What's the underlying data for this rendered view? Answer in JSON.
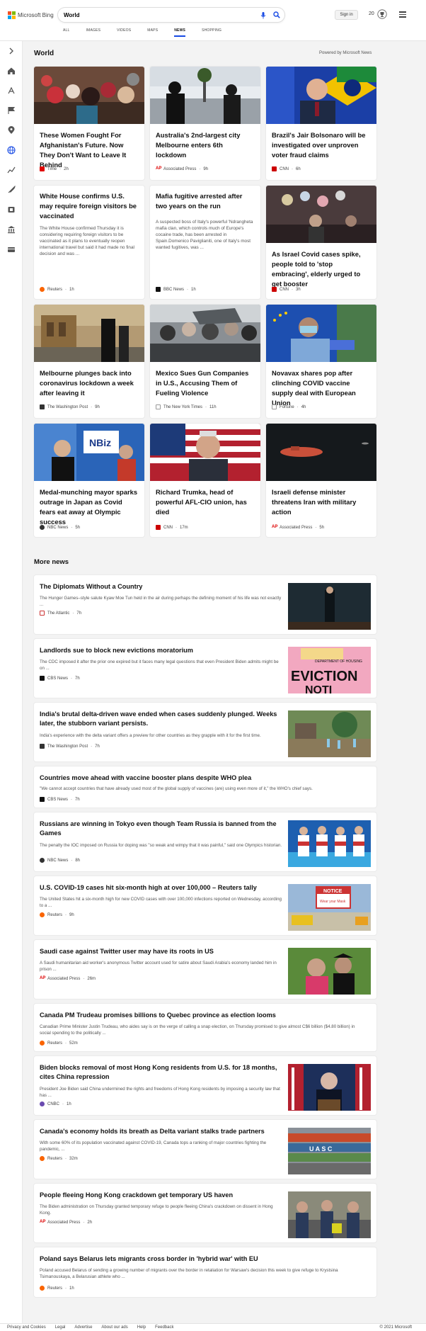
{
  "header": {
    "logo_text": "Microsoft Bing",
    "search_value": "World",
    "signin_label": "Sign in",
    "rewards_count": "20"
  },
  "tabs": [
    "ALL",
    "IMAGES",
    "VIDEOS",
    "MAPS",
    "NEWS",
    "SHOPPING"
  ],
  "section": {
    "title": "World",
    "powered": "Powered by Microsoft News"
  },
  "cards": [
    {
      "title": "These Women Fought For Afghanistan's Future. Now They Don't Want to Leave It Behind",
      "desc": "",
      "source": "Time",
      "time": "2h"
    },
    {
      "title": "Australia's 2nd-largest city Melbourne enters 6th lockdown",
      "desc": "",
      "source": "Associated Press",
      "time": "9h"
    },
    {
      "title": "Brazil's Jair Bolsonaro will be investigated over unproven voter fraud claims",
      "desc": "",
      "source": "CNN",
      "time": "6h"
    },
    {
      "title": "White House confirms U.S. may require foreign visitors be vaccinated",
      "desc": "The White House confirmed Thursday it is considering requiring foreign visitors to be vaccinated as it plans to eventually reopen international travel but said it had made no final decision and was ...",
      "source": "Reuters",
      "time": "1h"
    },
    {
      "title": "Mafia fugitive arrested after two years on the run",
      "desc": "A suspected boss of Italy's powerful 'Ndrangheta mafia clan, which controls much of Europe's cocaine trade, has been arrested in Spain.Domenico Paviglianiti, one of Italy's most wanted fugitives, was ...",
      "source": "BBC News",
      "time": "1h"
    },
    {
      "title": "As Israel Covid cases spike, people told to 'stop embracing', elderly urged to get booster",
      "desc": "",
      "source": "CNN",
      "time": "3h"
    },
    {
      "title": "Melbourne plunges back into coronavirus lockdown a week after leaving it",
      "desc": "",
      "source": "The Washington Post",
      "time": "9h"
    },
    {
      "title": "Mexico Sues Gun Companies in U.S., Accusing Them of Fueling Violence",
      "desc": "",
      "source": "The New York Times",
      "time": "11h"
    },
    {
      "title": "Novavax shares pop after clinching COVID vaccine supply deal with European Union",
      "desc": "",
      "source": "Fortune",
      "time": "4h"
    },
    {
      "title": "Medal-munching mayor sparks outrage in Japan as Covid fears eat away at Olympic success",
      "desc": "",
      "source": "NBC News",
      "time": "5h"
    },
    {
      "title": "Richard Trumka, head of powerful AFL-CIO union, has died",
      "desc": "",
      "source": "CNN",
      "time": "17m"
    },
    {
      "title": "Israeli defense minister threatens Iran with military action",
      "desc": "",
      "source": "Associated Press",
      "time": "5h"
    }
  ],
  "more_news": {
    "title": "More news",
    "items": [
      {
        "title": "The Diplomats Without a Country",
        "desc": "The Hunger Games–style salute Kyaw Moe Tun held in the air during perhaps the defining moment of his life was not exactly ...",
        "source": "The Atlantic",
        "time": "7h"
      },
      {
        "title": "Landlords sue to block new evictions moratorium",
        "desc": "The CDC imposed it after the prior one expired but it faces many legal questions that even President Biden admits might be on ...",
        "source": "CBS News",
        "time": "7h"
      },
      {
        "title": "India's brutal delta-driven wave ended when cases suddenly plunged. Weeks later, the stubborn variant persists.",
        "desc": "India's experience with the delta variant offers a preview for other countries as they grapple with it for the first time.",
        "source": "The Washington Post",
        "time": "7h"
      },
      {
        "title": "Countries move ahead with vaccine booster plans despite WHO plea",
        "desc": "\"We cannot accept countries that have already used most of the global supply of vaccines (are) using even more of it,\" the WHO's chief says.",
        "source": "CBS News",
        "time": "7h"
      },
      {
        "title": "Russians are winning in Tokyo even though Team Russia is banned from the Games",
        "desc": "The penalty the IOC imposed on Russia for doping was \"so weak and wimpy that it was painful,\" said one Olympics historian.",
        "source": "NBC News",
        "time": "8h"
      },
      {
        "title": "U.S. COVID-19 cases hit six-month high at over 100,000 – Reuters tally",
        "desc": "The United States hit a six-month high for new COVID cases with over 100,000 infections reported on Wednesday, according to a ...",
        "source": "Reuters",
        "time": "9h"
      },
      {
        "title": "Saudi case against Twitter user may have its roots in US",
        "desc": "A Saudi humanitarian aid worker's anonymous Twitter account used for satire about Saudi Arabia's economy landed him in prison ...",
        "source": "Associated Press",
        "time": "26m"
      },
      {
        "title": "Canada PM Trudeau promises billions to Quebec province as election looms",
        "desc": "Canadian Prime Minister Justin Trudeau, who aides say is on the verge of calling a snap election, on Thursday promised to give almost C$6 billion ($4.80 billion) in social spending to the politically ...",
        "source": "Reuters",
        "time": "52m"
      },
      {
        "title": "Biden blocks removal of most Hong Kong residents from U.S. for 18 months, cites China repression",
        "desc": "President Joe Biden said China undermined the rights and freedoms of Hong Kong residents by imposing a security law that has ...",
        "source": "CNBC",
        "time": "1h"
      },
      {
        "title": "Canada's economy holds its breath as Delta variant stalks trade partners",
        "desc": "With some 60% of its population vaccinated against COVID-19, Canada tops a ranking of major countries fighting the pandemic, ...",
        "source": "Reuters",
        "time": "32m"
      },
      {
        "title": "People fleeing Hong Kong crackdown get temporary US haven",
        "desc": "The Biden administration on Thursday granted temporary refuge to people fleeing China's crackdown on dissent in Hong Kong.",
        "source": "Associated Press",
        "time": "2h"
      },
      {
        "title": "Poland says Belarus lets migrants cross border in 'hybrid war' with EU",
        "desc": "Poland accused Belarus of sending a growing number of migrants over the border in retaliation for Warsaw's decision this week to give refuge to Krystsina Tsimanouskaya, a Belarusian athlete who ...",
        "source": "Reuters",
        "time": "1h"
      }
    ]
  },
  "images": {
    "eviction_sign_top": "DEPARTMENT OF HOUSING",
    "eviction_sign_main": "EVICTION",
    "eviction_sign_bottom": "NOTI",
    "notice_sign_top": "NOTICE",
    "notice_sign_bottom": "Wear your Mask",
    "container_text": "U A S C",
    "nbiz_text": "NBiz"
  },
  "footer": {
    "links": [
      "Privacy and Cookies",
      "Legal",
      "Advertise",
      "About our ads",
      "Help",
      "Feedback"
    ],
    "copyright": "© 2021 Microsoft"
  }
}
